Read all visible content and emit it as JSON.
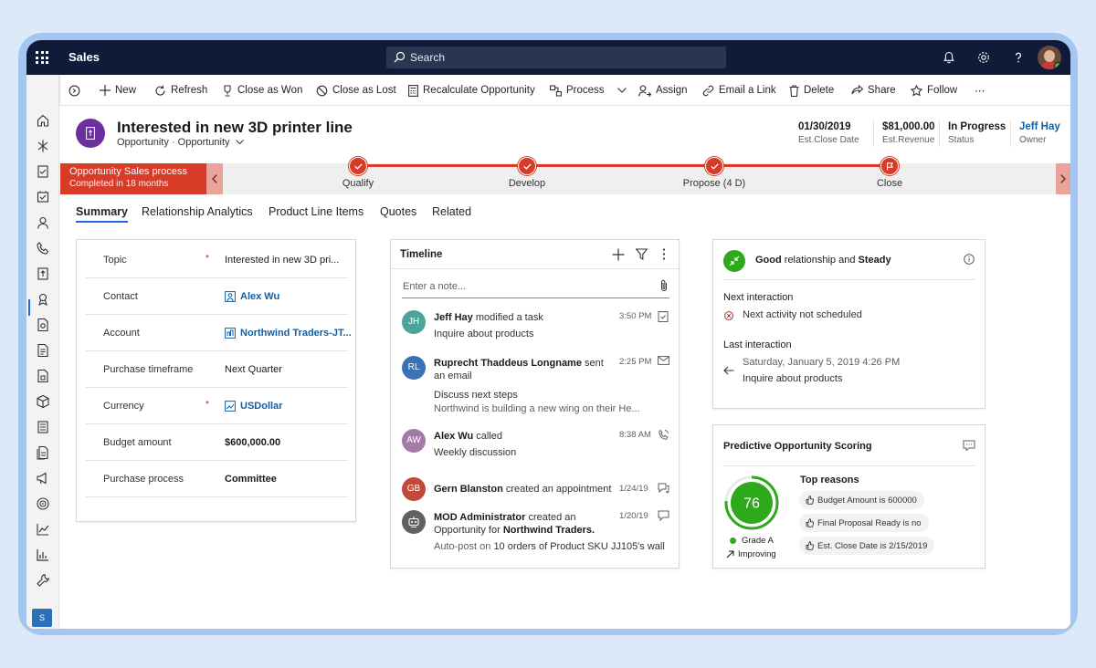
{
  "app": {
    "name": "Sales"
  },
  "search": {
    "placeholder": "Search"
  },
  "commands": {
    "new": "New",
    "refresh": "Refresh",
    "close_won": "Close as Won",
    "close_lost": "Close as Lost",
    "recalculate": "Recalculate Opportunity",
    "process": "Process",
    "assign": "Assign",
    "email_link": "Email a Link",
    "delete": "Delete",
    "share": "Share",
    "follow": "Follow",
    "more": "⋯"
  },
  "record": {
    "title": "Interested in new 3D printer line",
    "entity": "Opportunity",
    "form": "Opportunity",
    "close_date": "01/30/2019",
    "close_date_label": "Est.Close Date",
    "revenue": "$81,000.00",
    "revenue_label": "Est.Revenue",
    "status": "In Progress",
    "status_label": "Status",
    "owner": "Jeff Hay",
    "owner_label": "Owner"
  },
  "bpf": {
    "name": "Opportunity Sales process",
    "status": "Completed in 18 months",
    "stages": [
      "Qualify",
      "Develop",
      "Propose (4 D)",
      "Close"
    ]
  },
  "tabs": [
    "Summary",
    "Relationship Analytics",
    "Product Line Items",
    "Quotes",
    "Related"
  ],
  "summary_fields": [
    {
      "label": "Topic",
      "required": "*",
      "value": "Interested in new 3D pri..."
    },
    {
      "label": "Contact",
      "required": "",
      "value": "Alex Wu"
    },
    {
      "label": "Account",
      "required": "",
      "value": "Northwind Traders-JT..."
    },
    {
      "label": "Purchase timeframe",
      "required": "",
      "value": "Next Quarter"
    },
    {
      "label": "Currency",
      "required": "*",
      "value": "USDollar"
    },
    {
      "label": "Budget amount",
      "required": "",
      "value": "$600,000.00"
    },
    {
      "label": "Purchase process",
      "required": "",
      "value": "Committee"
    }
  ],
  "timeline": {
    "title": "Timeline",
    "note_placeholder": "Enter a note...",
    "items": [
      {
        "initials": "JH",
        "color": "#4ba39a",
        "actor": "Jeff Hay",
        "action": " modified a task",
        "time": "3:50 PM",
        "line1": "Inquire about products",
        "line2": ""
      },
      {
        "initials": "RL",
        "color": "#3a72b8",
        "actor": "Ruprecht Thaddeus Longname",
        "action": " sent an email",
        "time": "2:25 PM",
        "line1": "Discuss next steps",
        "line2": "Northwind is building a new wing on their He..."
      },
      {
        "initials": "AW",
        "color": "#a67aa6",
        "actor": "Alex Wu",
        "action": " called",
        "time": "8:38 AM",
        "line1": "Weekly discussion",
        "line2": ""
      },
      {
        "initials": "GB",
        "color": "#c24a3a",
        "actor": "Gern Blanston",
        "action": " created an appointment",
        "time": "1/24/19",
        "line1": "",
        "line2": ""
      },
      {
        "initials": "",
        "color": "#616161",
        "actor": "MOD Administrator",
        "action": " created an Opportunity for ",
        "target": "Northwind Traders.",
        "time": "1/20/19",
        "line1": "Auto-post on ",
        "line1b": "10 orders of Product SKU JJ105's wall",
        "line2": ""
      }
    ]
  },
  "relationship": {
    "health_good": "Good",
    "health_mid": " relationship and ",
    "health_trend": "Steady",
    "next_label": "Next interaction",
    "next_value": "Next activity not scheduled",
    "last_label": "Last interaction",
    "last_date": "Saturday, January 5, 2019 4:26 PM",
    "last_subject": "Inquire about products"
  },
  "scoring": {
    "title": "Predictive Opportunity Scoring",
    "score": "76",
    "score_fraction": 0.76,
    "grade": "Grade A",
    "trend": "Improving",
    "reasons_title": "Top reasons",
    "reasons": [
      "Budget Amount is 600000",
      "Final Proposal Ready is no",
      "Est. Close Date is 2/15/2019"
    ]
  },
  "rail": {
    "badge": "S"
  },
  "colors": {
    "accent": "#2266e3",
    "bpf_red": "#d83b28",
    "nav": "#0f1b38",
    "score_green": "#2ea91b"
  }
}
